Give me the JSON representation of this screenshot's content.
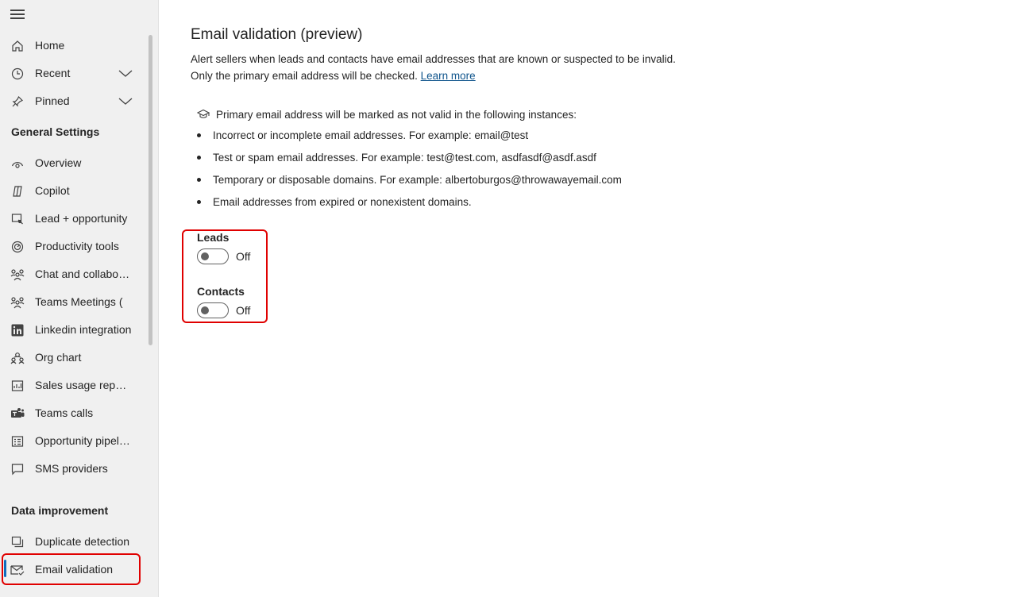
{
  "sidebar": {
    "top_items": [
      {
        "label": "Home",
        "icon": "home-icon"
      },
      {
        "label": "Recent",
        "icon": "clock-icon"
      },
      {
        "label": "Pinned",
        "icon": "pin-icon"
      }
    ],
    "general_settings_header": "General Settings",
    "general_items": [
      {
        "label": "Overview",
        "icon": "overview-icon"
      },
      {
        "label": "Copilot",
        "icon": "copilot-icon"
      },
      {
        "label": "Lead + opportunity",
        "icon": "lead-icon"
      },
      {
        "label": "Productivity tools",
        "icon": "gauge-icon"
      },
      {
        "label": "Chat and collaboration",
        "icon": "people-icon"
      },
      {
        "label": "Teams Meetings (",
        "icon": "people-icon"
      },
      {
        "label": "Linkedin integration",
        "icon": "linkedin-icon"
      },
      {
        "label": "Org chart",
        "icon": "org-chart-icon"
      },
      {
        "label": "Sales usage reports",
        "icon": "report-icon"
      },
      {
        "label": "Teams calls",
        "icon": "teams-icon"
      },
      {
        "label": "Opportunity pipeline",
        "icon": "pipeline-icon"
      },
      {
        "label": "SMS providers",
        "icon": "chat-bubble-icon"
      }
    ],
    "data_improvement_header": "Data improvement",
    "data_items": [
      {
        "label": "Duplicate detection",
        "icon": "duplicate-icon"
      },
      {
        "label": "Email validation",
        "icon": "mail-check-icon",
        "active": true
      }
    ]
  },
  "main": {
    "title": "Email validation (preview)",
    "description_line1": "Alert sellers when leads and contacts have email addresses that are known or suspected to be invalid.",
    "description_line2": "Only the primary email address will be checked.",
    "learn_more": "Learn more",
    "info_text": "Primary email address will be marked as not valid in the following instances:",
    "bullets": [
      "Incorrect or incomplete email addresses. For example: email@test",
      "Test or spam email addresses. For example: test@test.com, asdfasdf@asdf.asdf",
      "Temporary or disposable domains. For example: albertoburgos@throwawayemail.com",
      "Email addresses from expired or nonexistent domains."
    ],
    "toggles": [
      {
        "label": "Leads",
        "state": "Off"
      },
      {
        "label": "Contacts",
        "state": "Off"
      }
    ]
  },
  "colors": {
    "accent": "#0f6cbd",
    "highlight": "#e00000",
    "sidebar_bg": "#f0f0f0"
  }
}
